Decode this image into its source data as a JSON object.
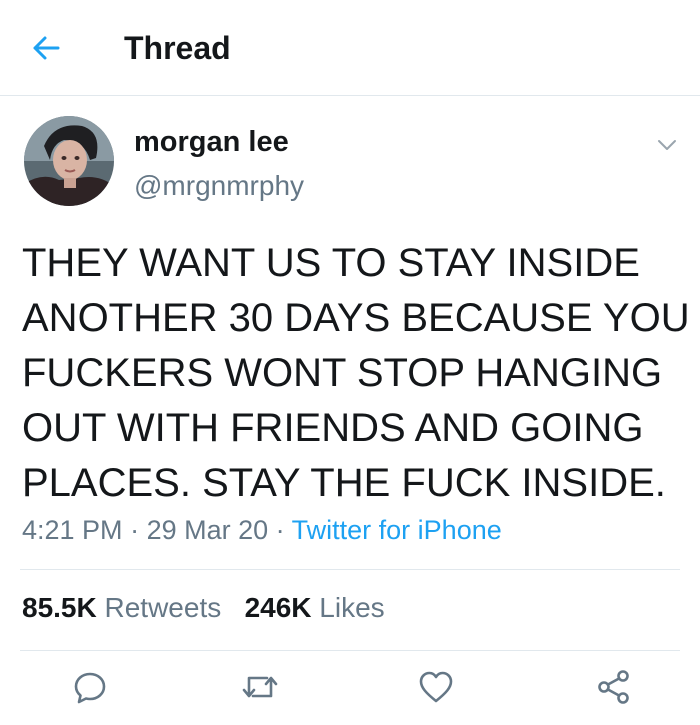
{
  "header": {
    "title": "Thread",
    "back_icon": "arrow-left-icon",
    "accent_color": "#1da1f2"
  },
  "tweet": {
    "author_name": "morgan lee",
    "author_handle": "@mrgnmrphy",
    "menu_icon": "chevron-down-icon",
    "text": "THEY WANT US TO STAY INSIDE\nANOTHER 30 DAYS BECAUSE YOU\nFUCKERS WONT STOP HANGING\nOUT WITH FRIENDS AND GOING\nPLACES. STAY THE FUCK INSIDE.",
    "time": "4:21 PM",
    "separator": " · ",
    "date": "29 Mar 20",
    "source": "Twitter for iPhone"
  },
  "stats": {
    "retweets_count": "85.5K",
    "retweets_label": "Retweets",
    "likes_count": "246K",
    "likes_label": "Likes"
  },
  "actions": [
    {
      "name": "reply",
      "icon": "reply-icon"
    },
    {
      "name": "retweet",
      "icon": "retweet-icon"
    },
    {
      "name": "like",
      "icon": "heart-icon"
    },
    {
      "name": "share",
      "icon": "share-icon"
    }
  ],
  "colors": {
    "text_primary": "#14171a",
    "text_secondary": "#657786",
    "link": "#1da1f2",
    "divider": "#e1e8ed"
  }
}
